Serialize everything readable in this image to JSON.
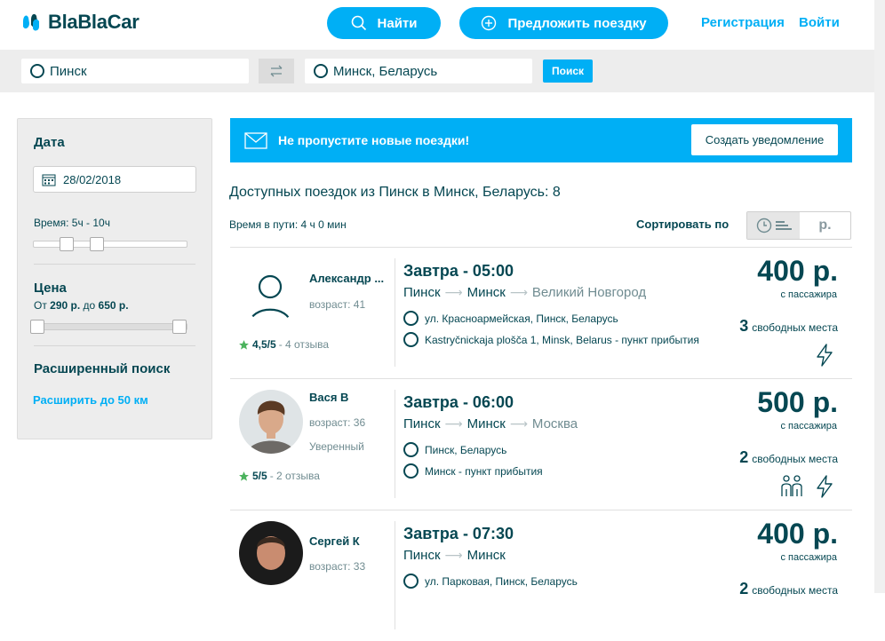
{
  "header": {
    "logo": "BlaBlaCar",
    "find_label": "Найти",
    "offer_label": "Предложить поездку",
    "register_label": "Регистрация",
    "login_label": "Войти"
  },
  "search": {
    "from": "Пинск",
    "to": "Минск, Беларусь",
    "button_label": "Поиск"
  },
  "sidebar": {
    "date_title": "Дата",
    "date_value": "28/02/2018",
    "time_label": "Время: 5ч - 10ч",
    "price_title": "Цена",
    "price_prefix": "От ",
    "price_from": "290 р.",
    "price_mid": " до ",
    "price_to": "650 р.",
    "advanced_title": "Расширенный поиск",
    "expand_link": "Расширить до 50 км"
  },
  "banner": {
    "text": "Не пропустите новые поездки!",
    "button_label": "Создать уведомление"
  },
  "results": {
    "title": "Доступных поездок из Пинск в Минск, Беларусь: 8",
    "duration": "Время в пути: 4 ч 0 мин",
    "sort_label": "Сортировать по",
    "sort_price": "р."
  },
  "rides": [
    {
      "driver": "Александр ...",
      "age": "возраст: 41",
      "experience": "",
      "rating": "4,5/5",
      "reviews": " - 4 отзыва",
      "time": "Завтра - 05:00",
      "from": "Пинск",
      "to": "Минск",
      "via": "Великий Новгород",
      "stop1": "ул. Красноармейская, Пинск, Беларусь",
      "stop2": "Kastryčnickaja plošča 1, Minsk, Belarus - пункт прибытия",
      "price": "400 р.",
      "price_sub": "с пассажира",
      "seats": "3",
      "seats_label": "свободных места"
    },
    {
      "driver": "Вася В",
      "age": "возраст: 36",
      "experience": "Уверенный",
      "rating": "5/5",
      "reviews": " - 2 отзыва",
      "time": "Завтра - 06:00",
      "from": "Пинск",
      "to": "Минск",
      "via": "Москва",
      "stop1": "Пинск, Беларусь",
      "stop2": "Минск - пункт прибытия",
      "price": "500 р.",
      "price_sub": "с пассажира",
      "seats": "2",
      "seats_label": "свободных места"
    },
    {
      "driver": "Сергей К",
      "age": "возраст: 33",
      "time": "Завтра - 07:30",
      "from": "Пинск",
      "to": "Минск",
      "stop1": "ул. Парковая, Пинск, Беларусь",
      "price": "400 р.",
      "price_sub": "с пассажира",
      "seats": "2",
      "seats_label": "свободных места"
    }
  ],
  "colors": {
    "accent": "#00aff5",
    "text": "#054752",
    "muted": "#708c91",
    "star": "#4cb35e"
  }
}
